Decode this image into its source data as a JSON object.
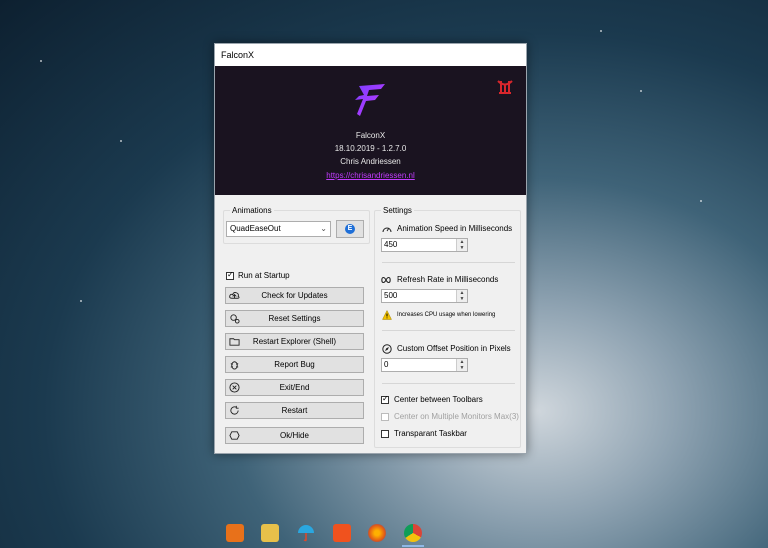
{
  "window": {
    "title": "FalconX"
  },
  "about": {
    "name": "FalconX",
    "version": "18.10.2019 - 1.2.7.0",
    "author": "Chris Andriessen",
    "url": "https://chrisandriessen.nl"
  },
  "animations": {
    "group_label": "Animations",
    "selected": "QuadEaseOut",
    "run_at_startup": "Run at Startup"
  },
  "buttons": {
    "check_updates": "Check for Updates",
    "reset_settings": "Reset Settings",
    "restart_explorer": "Restart Explorer (Shell)",
    "report_bug": "Report Bug",
    "exit": "Exit/End",
    "restart": "Restart",
    "ok_hide": "Ok/Hide"
  },
  "settings": {
    "group_label": "Settings",
    "anim_speed_label": "Animation Speed in Milliseconds",
    "anim_speed_value": "450",
    "refresh_label": "Refresh Rate in Milliseconds",
    "refresh_value": "500",
    "refresh_warning": "Increases CPU usage when lowering",
    "offset_label": "Custom Offset Position in Pixels",
    "offset_value": "0",
    "center_toolbars": "Center between Toolbars",
    "center_monitors": "Center on Multiple Monitors Max(3)",
    "transparent_taskbar": "Transparant Taskbar"
  },
  "icons": {
    "logo": "falconx-logo-icon",
    "corner": "app-emblem-icon"
  },
  "colors": {
    "banner_bg": "#1a1320",
    "link": "#c33cff",
    "logo_gradient_start": "#7b3dff",
    "logo_gradient_end": "#c43cff",
    "emblem": "#d8262c"
  }
}
